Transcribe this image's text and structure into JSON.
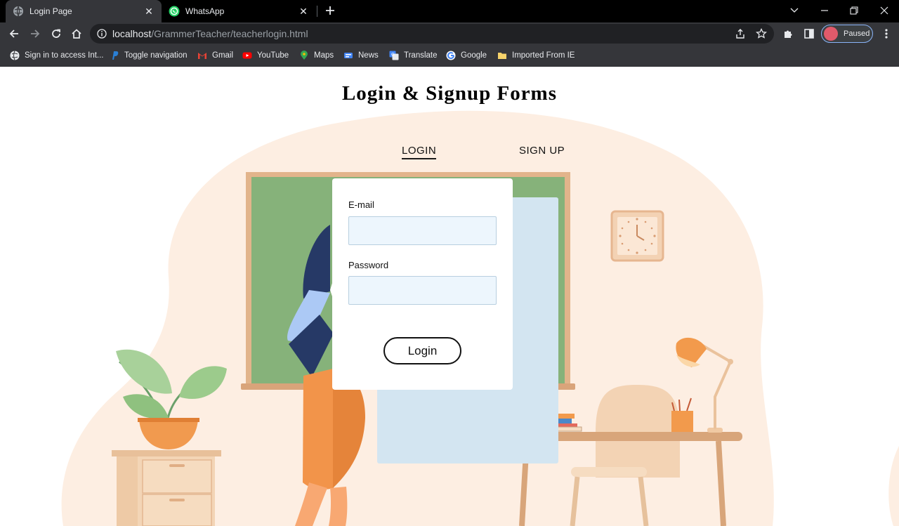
{
  "browser": {
    "tabs": [
      {
        "title": "Login Page",
        "active": true,
        "icon": "globe-icon"
      },
      {
        "title": "WhatsApp",
        "active": false,
        "icon": "whatsapp-icon"
      }
    ],
    "address": {
      "host": "localhost",
      "path": "/GrammerTeacher/teacherlogin.html"
    },
    "profile_status": "Paused",
    "bookmarks": [
      {
        "label": "Sign in to access Int...",
        "icon": "globe-icon"
      },
      {
        "label": "Toggle navigation",
        "icon": "paypal-icon"
      },
      {
        "label": "Gmail",
        "icon": "gmail-icon"
      },
      {
        "label": "YouTube",
        "icon": "youtube-icon"
      },
      {
        "label": "Maps",
        "icon": "maps-icon"
      },
      {
        "label": "News",
        "icon": "news-icon"
      },
      {
        "label": "Translate",
        "icon": "translate-icon"
      },
      {
        "label": "Google",
        "icon": "google-icon"
      },
      {
        "label": "Imported From IE",
        "icon": "folder-icon"
      }
    ]
  },
  "page": {
    "title": "Login & Signup Forms",
    "tabs": {
      "login": "LOGIN",
      "signup": "SIGN UP"
    },
    "form": {
      "email_label": "E-mail",
      "email_value": "",
      "password_label": "Password",
      "password_value": "",
      "submit_label": "Login"
    }
  },
  "colors": {
    "background_blob": "#fdeee2",
    "chalkboard": "#86b27a",
    "board_frame": "#e2b48b",
    "accent_orange": "#f2944a",
    "input_fill": "#edf6fd"
  }
}
